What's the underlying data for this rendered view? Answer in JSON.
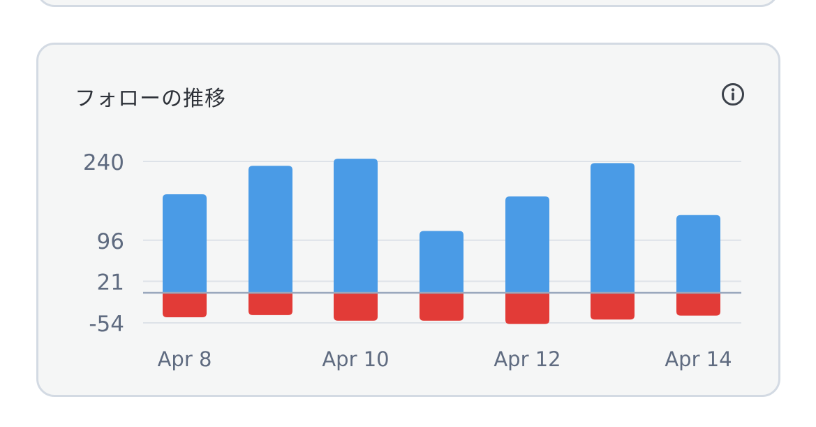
{
  "card": {
    "title": "フォローの推移"
  },
  "chart_data": {
    "type": "bar",
    "stacked": true,
    "categories": [
      "Apr 8",
      "Apr 9",
      "Apr 10",
      "Apr 11",
      "Apr 12",
      "Apr 13",
      "Apr 14"
    ],
    "x_tick_labels": [
      "Apr 8",
      "Apr 10",
      "Apr 12",
      "Apr 14"
    ],
    "y_tick_labels": [
      "240",
      "96",
      "21",
      "-54"
    ],
    "series": [
      {
        "values": [
          180,
          232,
          245,
          113,
          176,
          237,
          142
        ],
        "color": "#4a9be6"
      },
      {
        "values": [
          -44,
          -40,
          -50,
          -50,
          -56,
          -48,
          -41
        ],
        "color": "#e23b37"
      }
    ],
    "ylim": [
      -54,
      240
    ],
    "grid": true,
    "legend": "none"
  }
}
